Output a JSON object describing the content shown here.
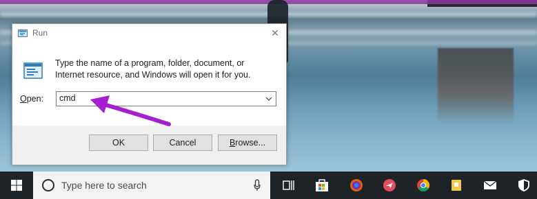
{
  "dialog": {
    "title": "Run",
    "description": "Type the name of a program, folder, document, or Internet resource, and Windows will open it for you.",
    "open_label_underlined": "O",
    "open_label_rest": "pen:",
    "command_value": "cmd",
    "buttons": {
      "ok": "OK",
      "cancel": "Cancel",
      "browse_underlined": "B",
      "browse_rest": "rowse..."
    }
  },
  "taskbar": {
    "search_placeholder": "Type here to search",
    "icons": [
      "windows-start-icon",
      "cortana-circle-icon",
      "microphone-icon",
      "task-view-icon",
      "store-icon",
      "firefox-icon",
      "messaging-icon",
      "chrome-icon",
      "notes-icon",
      "mail-icon",
      "shield-icon"
    ]
  },
  "colors": {
    "annotation_arrow": "#a31fd1",
    "taskbar_bg": "#1e2328",
    "dialog_bg": "#f0f0f0"
  }
}
